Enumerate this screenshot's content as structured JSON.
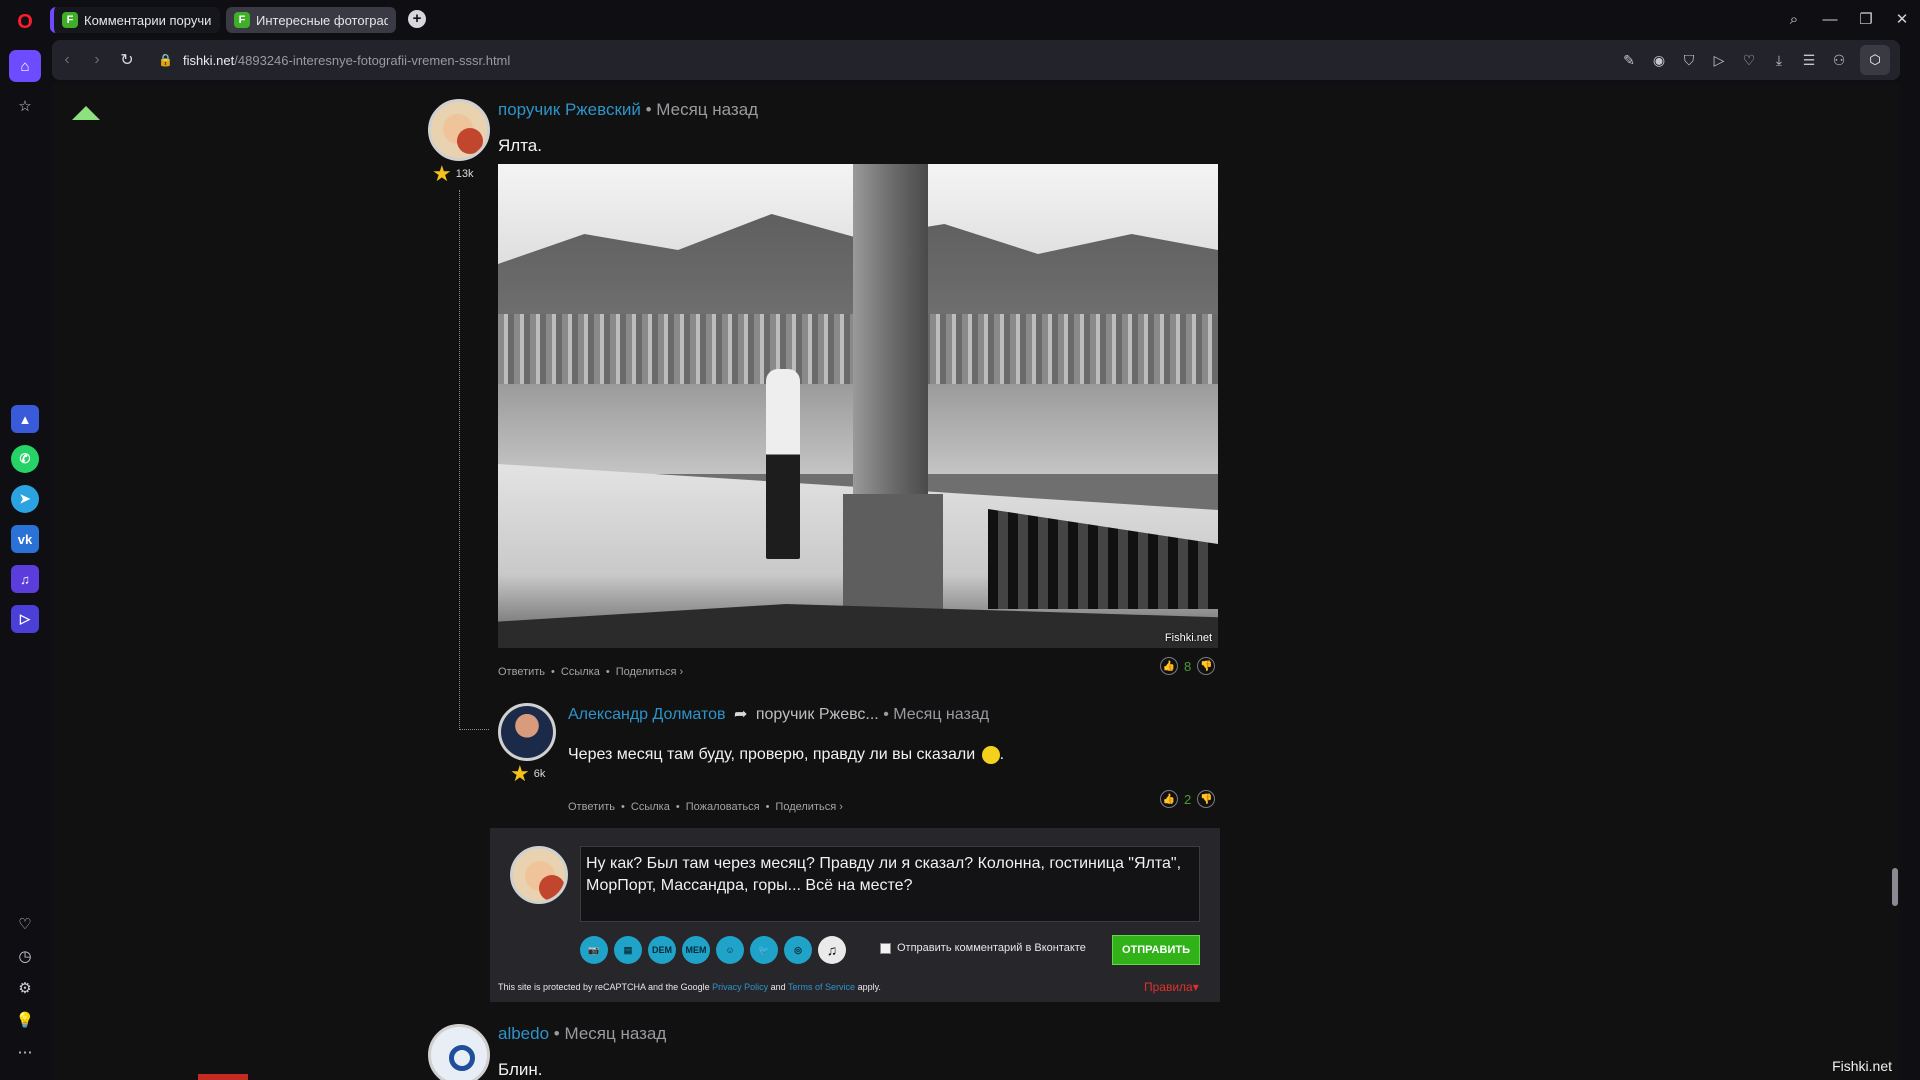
{
  "browser": {
    "tabs": [
      {
        "label": "Комментарии поручик Р",
        "favicon": "F",
        "active": false
      },
      {
        "label": "Интересные фотографии",
        "favicon": "F",
        "active": true
      }
    ],
    "url_host": "fishki.net",
    "url_path": "/4893246-interesnye-fotografii-vremen-sssr.html",
    "accent": "#6d4cff"
  },
  "sidebar": {
    "apps": [
      "aria-icon",
      "whatsapp-icon",
      "telegram-icon",
      "vk-icon",
      "music-icon",
      "player-icon"
    ],
    "bottom": [
      "heart-icon",
      "history-icon",
      "settings-icon",
      "tips-icon",
      "more-icon"
    ]
  },
  "comment1": {
    "author": "поручик Ржевский",
    "time": "• Месяц назад",
    "rating": "13k",
    "text": "Ялта.",
    "photo_watermark": "Fishki.net",
    "actions": [
      "Ответить",
      "Ссылка",
      "Поделиться ›"
    ],
    "votes": "8"
  },
  "comment2": {
    "author": "Александр Долматов",
    "reply_to": "поручик Ржевс...",
    "time": "• Месяц назад",
    "rating": "6k",
    "text": "Через месяц там буду, проверю, правду ли вы сказали",
    "text_end": ".",
    "actions": [
      "Ответить",
      "Ссылка",
      "Пожаловаться",
      "Поделиться ›"
    ],
    "votes": "2"
  },
  "reply_form": {
    "text": "Ну как? Был там через месяц? Правду ли я сказал? Колонна, гостиница \"Ялта\", МорПорт, Массандра, горы... Всё на месте?",
    "tools": [
      "📷",
      "▤",
      "DEM",
      "MEM",
      "☺",
      "🐦",
      "◎",
      "♫"
    ],
    "vk_label": "Отправить комментарий в Вконтакте",
    "send_label": "ОТПРАВИТЬ",
    "captcha_pre": "This site is protected by reCAPTCHA and the Google",
    "privacy": "Privacy Policy",
    "and": "and",
    "terms": "Terms of Service",
    "apply": "apply.",
    "rules": "Правила▾"
  },
  "comment3": {
    "author": "albedo",
    "time": "• Месяц назад",
    "text": "Блин."
  },
  "watermark": "Fishki.net"
}
